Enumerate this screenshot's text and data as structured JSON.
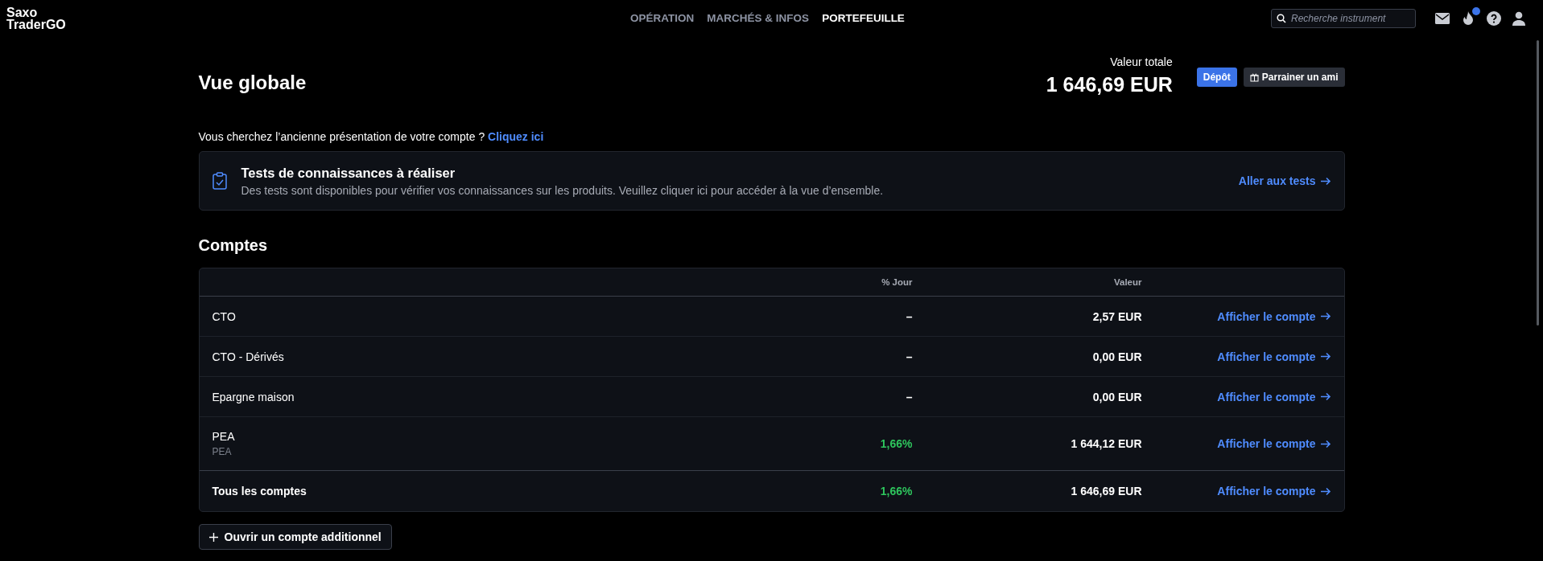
{
  "logo": {
    "line_1": "Saxo",
    "line_2": "TraderGO"
  },
  "nav": [
    {
      "label": "OPÉRATION",
      "selected": false
    },
    {
      "label": "MARCHÉS & INFOS",
      "selected": false
    },
    {
      "label": "PORTEFEUILLE",
      "selected": true
    }
  ],
  "search": {
    "placeholder": "Recherche instrument"
  },
  "alerts": {
    "has_notification": true
  },
  "header": {
    "title": "Vue globale",
    "total_label": "Valeur totale",
    "total_value": "1 646,69 EUR",
    "deposit_button": "Dépôt",
    "referral_button": "Parrainer un ami"
  },
  "legacy_notice": {
    "text": "Vous cherchez l’ancienne présentation de votre compte ?",
    "link": "Cliquez ici"
  },
  "banner": {
    "title": "Tests de connaissances à réaliser",
    "text": "Des tests sont disponibles pour vérifier vos connaissances sur les produits. Veuillez cliquer ici pour accéder à la vue d’ensemble.",
    "link": "Aller aux tests"
  },
  "accounts": {
    "title": "Comptes",
    "columns": [
      "% Jour",
      "Valeur"
    ],
    "rows": [
      {
        "name": "CTO",
        "day_change": "–",
        "positive": false,
        "value": "2,57 EUR",
        "link": "Afficher le compte"
      },
      {
        "name": "CTO - Dérivés",
        "day_change": "–",
        "positive": false,
        "value": "0,00 EUR",
        "link": "Afficher le compte"
      },
      {
        "name": "Epargne maison",
        "day_change": "–",
        "positive": false,
        "value": "0,00 EUR",
        "link": "Afficher le compte"
      },
      {
        "name": "PEA",
        "subtitle": "PEA",
        "day_change": "1,66%",
        "positive": true,
        "value": "1 644,12 EUR",
        "link": "Afficher le compte"
      }
    ],
    "total": {
      "name": "Tous les comptes",
      "day_change": "1,66%",
      "positive": true,
      "value": "1 646,69 EUR",
      "link": "Afficher le compte"
    }
  },
  "open_account_button": "Ouvrir un compte additionnel"
}
